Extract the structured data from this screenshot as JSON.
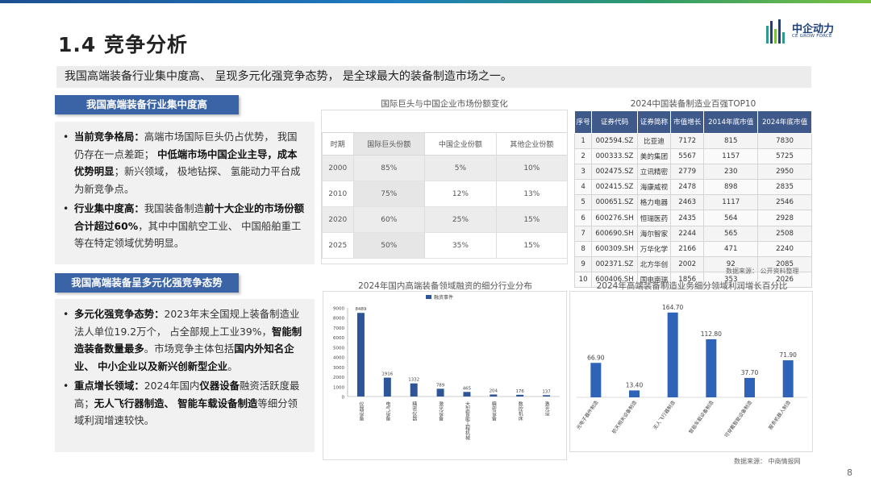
{
  "slide": {
    "title": "1.4 竞争分析",
    "page_number": "8",
    "logo": {
      "name": "中企动力",
      "sub": "CE GROW FORCE"
    },
    "banner": "我国高端装备行业集中度高、 呈现多元化强竞争态势， 是全球最大的装备制造市场之一。"
  },
  "section1": {
    "tag": "我国高端装备行业集中度高",
    "bullet1": {
      "label": "当前竞争格局：",
      "t1": "高端市场国际巨头仍占优势， 我国仍存在一点差距； ",
      "b1": "中低端市场中国企业主导，成本优势明显",
      "t2": "；新兴领域， 极地钻探、 氢能动力平台成为新竞争点。"
    },
    "bullet2": {
      "label": "行业集中度高：",
      "t1": "我国装备制造",
      "b1": "前十大企业的市场份额合计超过60%",
      "t2": "，其中中国航空工业、 中国船舶重工等在特定领域优势明显。"
    }
  },
  "section2": {
    "tag": "我国高端装备呈多元化强竞争态势",
    "bullet1": {
      "label": "多元化强竞争态势：",
      "t1": "2023年末全国规上装备制造业法人单位19.2万个， 占全部规上工业39%，",
      "b1": "智能制造装备数量最多",
      "t2": "。市场竞争主体包括",
      "b2": "国内外知名企业、 中小企业以及新兴创新型企业",
      "t3": "。"
    },
    "bullet2": {
      "label": "重点增长领域：",
      "t1": "2024年国内",
      "b1": "仪器设备",
      "t2": "融资活跃度最高；",
      "b2": "无人飞行器制造、 智能车载设备制造",
      "t3": "等细分领域利润增速较快。"
    }
  },
  "share_table": {
    "title": "国际巨头与中国企业市场份额变化",
    "headers": [
      "时期",
      "国际巨头份额",
      "中国企业份额",
      "其他企业份额"
    ],
    "rows": [
      [
        "2000",
        "85%",
        "5%",
        "10%"
      ],
      [
        "2010",
        "75%",
        "12%",
        "13%"
      ],
      [
        "2020",
        "60%",
        "25%",
        "15%"
      ],
      [
        "2025",
        "50%",
        "35%",
        "15%"
      ]
    ]
  },
  "top10_table": {
    "title": "2024中国装备制造业百强TOP10",
    "headers": [
      "序号",
      "证券代码",
      "证券简称",
      "市值增长",
      "2014年底市值",
      "2024年底市值"
    ],
    "rows": [
      [
        "1",
        "002594.SZ",
        "比亚迪",
        "7172",
        "815",
        "7830"
      ],
      [
        "2",
        "000333.SZ",
        "美的集团",
        "5567",
        "1157",
        "5725"
      ],
      [
        "3",
        "002475.SZ",
        "立讯精密",
        "2779",
        "230",
        "2950"
      ],
      [
        "4",
        "002415.SZ",
        "海康威视",
        "2478",
        "898",
        "2835"
      ],
      [
        "5",
        "000651.SZ",
        "格力电器",
        "2463",
        "1117",
        "2546"
      ],
      [
        "6",
        "600276.SH",
        "恒瑞医药",
        "2435",
        "564",
        "2928"
      ],
      [
        "7",
        "600690.SH",
        "海尔智家",
        "2244",
        "565",
        "2508"
      ],
      [
        "8",
        "600309.SH",
        "万华化学",
        "2166",
        "471",
        "2240"
      ],
      [
        "9",
        "002371.SZ",
        "北方华创",
        "2002",
        "92",
        "2085"
      ],
      [
        "10",
        "600406.SH",
        "国电南瑞",
        "1856",
        "353",
        "2026"
      ]
    ],
    "source": "数据来源： 公开资料整理"
  },
  "chart_data": [
    {
      "type": "bar",
      "title": "2024年国内高端装备领域融资的细分行业分布",
      "legend": "融资事件",
      "categories": [
        "仪器设备",
        "电气设备",
        "精密仪器",
        "激光设备",
        "大型智能工程机械",
        "精密设备",
        "数控机床",
        "激光设"
      ],
      "values": [
        8489,
        1916,
        1332,
        789,
        465,
        204,
        176,
        137
      ],
      "yticks": [
        "0",
        "1000",
        "2000",
        "3000",
        "4000",
        "5000",
        "6000",
        "7000",
        "8000",
        "9000"
      ],
      "ylim": [
        0,
        9000
      ],
      "color": "#2e5597"
    },
    {
      "type": "bar",
      "title": "2024年高端装备制造业务细分领域利润增长百分比",
      "categories": [
        "光电子器件制造",
        "航天相关设备制造",
        "无人飞行器制造",
        "智能车载设备制造",
        "可穿戴智能设备制造",
        "服务机器人制造"
      ],
      "values": [
        66.9,
        13.4,
        164.7,
        112.8,
        37.7,
        71.9
      ],
      "labels": [
        "66.90",
        "13.40",
        "164.70",
        "112.80",
        "37.70",
        "71.90"
      ],
      "ylim": [
        0,
        180
      ],
      "color": "#2e63b8",
      "source": "数据来源： 中商情报网"
    }
  ]
}
